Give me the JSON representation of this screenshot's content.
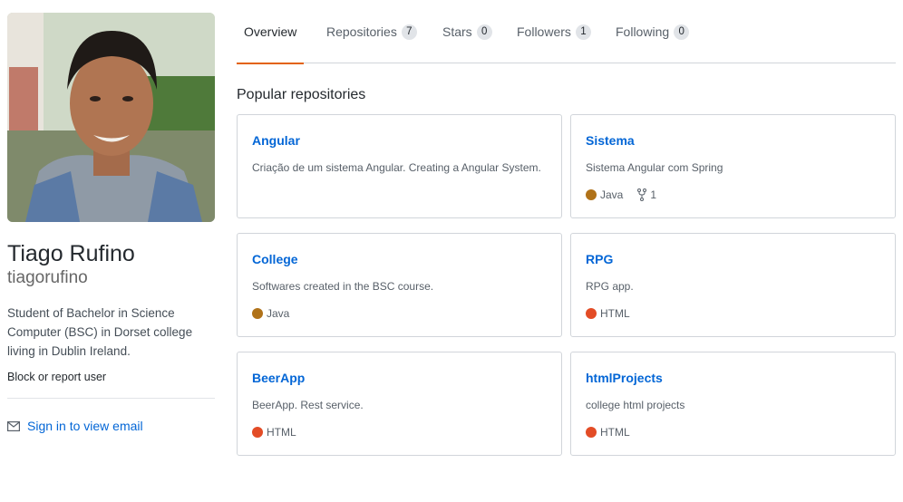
{
  "profile": {
    "full_name": "Tiago Rufino",
    "username": "tiagorufino",
    "bio": "Student of Bachelor in Science Computer (BSC) in Dorset college living in Dublin Ireland.",
    "report_link": "Block or report user",
    "email_link": "Sign in to view email"
  },
  "tabs": [
    {
      "label": "Overview",
      "count": null,
      "active": true
    },
    {
      "label": "Repositories",
      "count": "7"
    },
    {
      "label": "Stars",
      "count": "0"
    },
    {
      "label": "Followers",
      "count": "1"
    },
    {
      "label": "Following",
      "count": "0"
    }
  ],
  "section_title": "Popular repositories",
  "repos": [
    {
      "name": "Angular",
      "description": "Criação de um sistema Angular. Creating a Angular System.",
      "language": null,
      "color": null,
      "forks": null
    },
    {
      "name": "Sistema",
      "description": "Sistema Angular com Spring",
      "language": "Java",
      "color": "#b07219",
      "forks": "1"
    },
    {
      "name": "College",
      "description": "Softwares created in the BSC course.",
      "language": "Java",
      "color": "#b07219",
      "forks": null
    },
    {
      "name": "RPG",
      "description": "RPG app.",
      "language": "HTML",
      "color": "#e34c26",
      "forks": null
    },
    {
      "name": "BeerApp",
      "description": "BeerApp. Rest service.",
      "language": "HTML",
      "color": "#e34c26",
      "forks": null
    },
    {
      "name": "htmlProjects",
      "description": "college html projects",
      "language": "HTML",
      "color": "#e34c26",
      "forks": null
    }
  ],
  "colors": {
    "accent_tab": "#e36209",
    "link": "#0366d6"
  },
  "icons": {
    "email": "mail-icon",
    "forks": "repo-forked-icon"
  }
}
